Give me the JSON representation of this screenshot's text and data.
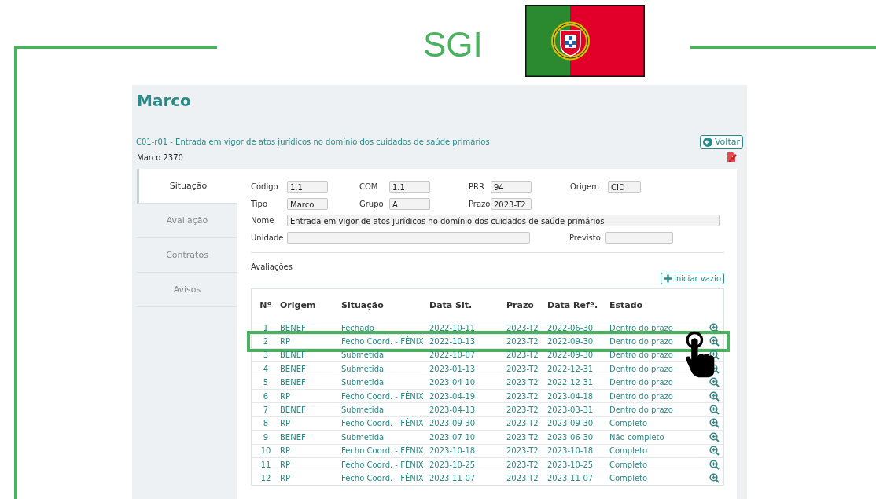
{
  "header": {
    "title": "SGI"
  },
  "page": {
    "title": "Marco",
    "subtitle": "C01-r01 - Entrada em vigor de atos jurídicos no domínio dos cuidados de saúde primários",
    "reference": "Marco 2370",
    "back_button": "Voltar"
  },
  "tabs": [
    {
      "label": "Situação",
      "selected": true
    },
    {
      "label": "Avaliação",
      "selected": false
    },
    {
      "label": "Contratos",
      "selected": false
    },
    {
      "label": "Avisos",
      "selected": false
    }
  ],
  "fields": {
    "codigo": {
      "label": "Código",
      "value": "1.1"
    },
    "com": {
      "label": "COM",
      "value": "1.1"
    },
    "prr": {
      "label": "PRR",
      "value": "94"
    },
    "origem": {
      "label": "Origem",
      "value": "CID"
    },
    "tipo": {
      "label": "Tipo",
      "value": "Marco"
    },
    "grupo": {
      "label": "Grupo",
      "value": "A"
    },
    "prazo": {
      "label": "Prazo",
      "value": "2023-T2"
    },
    "nome": {
      "label": "Nome",
      "value": "Entrada em vigor de atos jurídicos no domínio dos cuidados de saúde primários"
    },
    "unidade": {
      "label": "Unidade"
    },
    "previsto": {
      "label": "Previsto"
    }
  },
  "evaluations": {
    "title": "Avaliações",
    "add_button": "Iniciar vazio",
    "columns": [
      "Nº",
      "Origem",
      "Situação",
      "Data Sit.",
      "Prazo",
      "Data Refª.",
      "Estado"
    ],
    "rows": [
      {
        "cells": [
          "1",
          "BENEF",
          "Fechado",
          "2022-10-11",
          "2023-T2",
          "2022-06-30",
          "Dentro do prazo"
        ],
        "highlighted": false
      },
      {
        "cells": [
          "2",
          "RP",
          "Fecho Coord. - FÉNIX",
          "2022-10-13",
          "2023-T2",
          "2022-09-30",
          "Dentro do prazo"
        ],
        "highlighted": true
      },
      {
        "cells": [
          "3",
          "BENEF",
          "Submetida",
          "2022-10-07",
          "2023-T2",
          "2022-09-30",
          "Dentro do prazo"
        ],
        "highlighted": false
      },
      {
        "cells": [
          "4",
          "BENEF",
          "Submetida",
          "2023-01-13",
          "2023-T2",
          "2022-12-31",
          "Dentro do prazo"
        ],
        "highlighted": false
      },
      {
        "cells": [
          "5",
          "BENEF",
          "Submetida",
          "2023-04-10",
          "2023-T2",
          "2022-12-31",
          "Dentro do prazo"
        ],
        "highlighted": false
      },
      {
        "cells": [
          "6",
          "RP",
          "Fecho Coord. - FÉNIX",
          "2023-04-19",
          "2023-T2",
          "2023-04-18",
          "Dentro do prazo"
        ],
        "highlighted": false
      },
      {
        "cells": [
          "7",
          "BENEF",
          "Submetida",
          "2023-04-13",
          "2023-T2",
          "2023-03-31",
          "Dentro do prazo"
        ],
        "highlighted": false
      },
      {
        "cells": [
          "8",
          "RP",
          "Fecho Coord. - FÉNIX",
          "2023-09-30",
          "2023-T2",
          "2023-09-30",
          "Completo"
        ],
        "highlighted": false
      },
      {
        "cells": [
          "9",
          "BENEF",
          "Submetida",
          "2023-07-10",
          "2023-T2",
          "2023-06-30",
          "Não completo"
        ],
        "highlighted": false
      },
      {
        "cells": [
          "10",
          "RP",
          "Fecho Coord. - FÉNIX",
          "2023-10-18",
          "2023-T2",
          "2023-10-18",
          "Completo"
        ],
        "highlighted": false
      },
      {
        "cells": [
          "11",
          "RP",
          "Fecho Coord. - FÉNIX",
          "2023-10-25",
          "2023-T2",
          "2023-10-25",
          "Completo"
        ],
        "highlighted": false
      },
      {
        "cells": [
          "12",
          "RP",
          "Fecho Coord. - FÉNIX",
          "2023-11-07",
          "2023-T2",
          "2023-11-07",
          "Completo"
        ],
        "highlighted": false
      }
    ]
  }
}
